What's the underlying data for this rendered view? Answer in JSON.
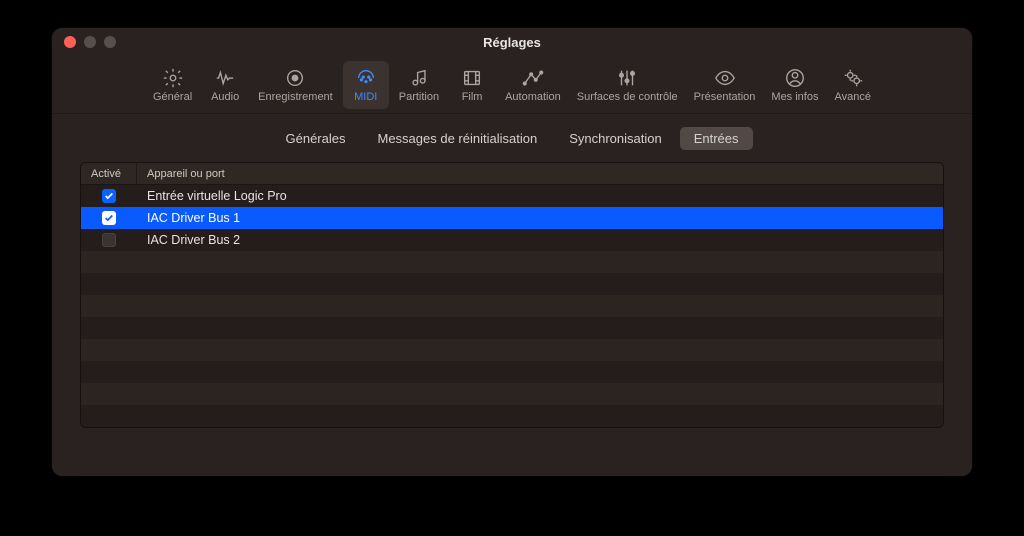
{
  "window": {
    "title": "Réglages"
  },
  "toolbar": {
    "items": [
      {
        "id": "general",
        "label": "Général"
      },
      {
        "id": "audio",
        "label": "Audio"
      },
      {
        "id": "recording",
        "label": "Enregistrement"
      },
      {
        "id": "midi",
        "label": "MIDI"
      },
      {
        "id": "score",
        "label": "Partition"
      },
      {
        "id": "film",
        "label": "Film"
      },
      {
        "id": "automation",
        "label": "Automation"
      },
      {
        "id": "surfaces",
        "label": "Surfaces de contrôle"
      },
      {
        "id": "display",
        "label": "Présentation"
      },
      {
        "id": "myinfo",
        "label": "Mes infos"
      },
      {
        "id": "advanced",
        "label": "Avancé"
      }
    ],
    "active": "midi"
  },
  "subtabs": {
    "items": [
      {
        "id": "generales",
        "label": "Générales"
      },
      {
        "id": "reset",
        "label": "Messages de réinitialisation"
      },
      {
        "id": "sync",
        "label": "Synchronisation"
      },
      {
        "id": "inputs",
        "label": "Entrées"
      }
    ],
    "active": "inputs"
  },
  "table": {
    "headers": {
      "enabled": "Activé",
      "device": "Appareil ou port"
    },
    "rows": [
      {
        "enabled": true,
        "selected": false,
        "device": "Entrée virtuelle Logic Pro"
      },
      {
        "enabled": true,
        "selected": true,
        "device": "IAC Driver Bus 1"
      },
      {
        "enabled": false,
        "selected": false,
        "device": "IAC Driver Bus 2"
      }
    ],
    "empty_row_count": 8
  }
}
